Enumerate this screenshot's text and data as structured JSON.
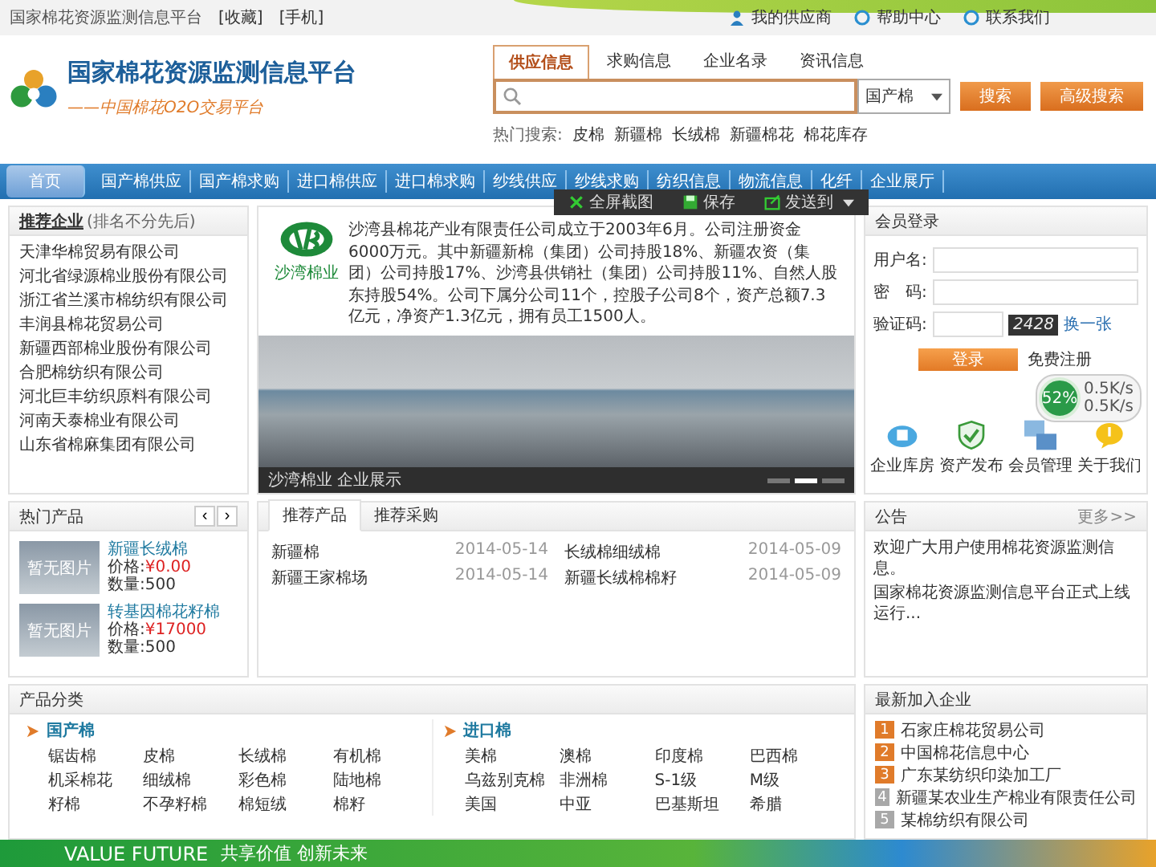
{
  "top_bar": {
    "site_name": "国家棉花资源监测信息平台",
    "links": [
      "[收藏]",
      "[手机]"
    ],
    "right_links": [
      "我的供应商",
      "帮助中心",
      "联系我们"
    ]
  },
  "header": {
    "title": "国家棉花资源监测信息平台",
    "slogan": "——中国棉花O2O交易平台",
    "search_tabs": [
      {
        "label": "供应信息",
        "selected": true
      },
      {
        "label": "求购信息",
        "selected": false
      },
      {
        "label": "企业名录",
        "selected": false
      },
      {
        "label": "资讯信息",
        "selected": false
      }
    ],
    "search": {
      "scope": "国产棉",
      "buttons": [
        "搜索",
        "高级搜索"
      ]
    },
    "hot_label": "热门搜索:",
    "hot_terms": [
      "皮棉",
      "新疆棉",
      "长绒棉",
      "新疆棉花",
      "棉花库存"
    ]
  },
  "nav": [
    {
      "label": "首页",
      "selected": true
    },
    {
      "label": "国产棉供应",
      "selected": false
    },
    {
      "label": "国产棉求购",
      "selected": false
    },
    {
      "label": "进口棉供应",
      "selected": false
    },
    {
      "label": "进口棉求购",
      "selected": false
    },
    {
      "label": "纱线供应",
      "selected": false
    },
    {
      "label": "纱线求购",
      "selected": false
    },
    {
      "label": "纺织信息",
      "selected": false
    },
    {
      "label": "物流信息",
      "selected": false
    },
    {
      "label": "化纤",
      "selected": false
    },
    {
      "label": "企业展厅",
      "selected": false
    }
  ],
  "capture_toolbar": [
    "全屏截图",
    "保存",
    "发送到"
  ],
  "recommended_companies": {
    "title": "推荐企业",
    "note": "(排名不分先后)",
    "items": [
      "天津华棉贸易有限公司",
      "河北省绿源棉业股份有限公司",
      "浙江省兰溪市棉纺织有限公司",
      "丰润县棉花贸易公司",
      "新疆西部棉业股份有限公司",
      "合肥棉纺织有限公司",
      "河北巨丰纺织原料有限公司",
      "河南天泰棉业有限公司",
      "山东省棉麻集团有限公司"
    ]
  },
  "banner": {
    "logo_caption": "沙湾棉业",
    "text": "沙湾县棉花产业有限责任公司成立于2003年6月。公司注册资金6000万元。其中新疆新棉（集团）公司持股18%、新疆农资（集团）公司持股17%、沙湾县供销社（集团）公司持股11%、自然人股东持股54%。公司下属分公司11个，控股子公司8个，资产总额7.3亿元，净资产1.3亿元，拥有员工1500人。",
    "caption": "沙湾棉业 企业展示",
    "slides": [
      {
        "selected": false
      },
      {
        "selected": true
      },
      {
        "selected": false
      }
    ]
  },
  "login": {
    "title": "会员登录",
    "fields": [
      {
        "label": "用户名:"
      },
      {
        "label": "密　码:"
      }
    ],
    "captcha_label": "验证码:",
    "captcha_image": "2428",
    "refresh": "换一张",
    "submit": "登录",
    "register": "免费注册",
    "shortcuts": [
      {
        "label": "企业库房",
        "kind": "cloud"
      },
      {
        "label": "资产发布",
        "kind": "shield"
      },
      {
        "label": "会员管理",
        "kind": "screens"
      },
      {
        "label": "关于我们",
        "kind": "bubble"
      }
    ]
  },
  "speed_widget": {
    "percent": "52%",
    "up": "0.5K/s",
    "down": "0.5K/s"
  },
  "hot_products": {
    "title": "热门产品",
    "prev": "‹",
    "next": "›",
    "items": [
      {
        "thumb": "暂无图片",
        "name": "新疆长绒棉",
        "price_label": "价格:",
        "price": "¥0.00",
        "qty_label": "数量:",
        "qty": "500"
      },
      {
        "thumb": "暂无图片",
        "name": "转基因棉花籽棉",
        "price_label": "价格:",
        "price": "¥17000",
        "qty_label": "数量:",
        "qty": "500"
      }
    ]
  },
  "product_tabs": {
    "tabs": [
      {
        "label": "推荐产品",
        "selected": true
      },
      {
        "label": "推荐采购",
        "selected": false
      }
    ],
    "rows": [
      {
        "name": "新疆棉",
        "date": "2014-05-14"
      },
      {
        "name": "新疆王家棉场",
        "date": "2014-05-14"
      },
      {
        "name": "长绒棉细绒棉",
        "date": "2014-05-09"
      },
      {
        "name": "新疆长绒棉棉籽",
        "date": "2014-05-09"
      }
    ]
  },
  "notices": {
    "title": "公告",
    "more": "更多>>",
    "items": [
      "欢迎广大用户使用棉花资源监测信息。",
      "国家棉花资源监测信息平台正式上线运行..."
    ]
  },
  "categories": {
    "title": "产品分类",
    "groups": [
      {
        "name": "国产棉",
        "items": [
          "锯齿棉",
          "皮棉",
          "长绒棉",
          "有机棉",
          "机采棉花",
          "细绒棉",
          "彩色棉",
          "陆地棉",
          "籽棉",
          "不孕籽棉",
          "棉短绒",
          "棉籽"
        ]
      },
      {
        "name": "进口棉",
        "items": [
          "美棉",
          "澳棉",
          "印度棉",
          "巴西棉",
          "乌兹别克棉",
          "非洲棉",
          "S-1级",
          "M级",
          "美国",
          "中亚",
          "巴基斯坦",
          "希腊"
        ]
      }
    ]
  },
  "new_companies": {
    "title": "最新加入企业",
    "items": [
      {
        "rank": "1",
        "name": "石家庄棉花贸易公司",
        "color": "#e07b2a"
      },
      {
        "rank": "2",
        "name": "中国棉花信息中心",
        "color": "#e07b2a"
      },
      {
        "rank": "3",
        "name": "广东某纺织印染加工厂",
        "color": "#e07b2a"
      },
      {
        "rank": "4",
        "name": "新疆某农业生产棉业有限责任公司",
        "color": "#a8a8a8"
      },
      {
        "rank": "5",
        "name": "某棉纺织有限公司",
        "color": "#a8a8a8"
      }
    ]
  },
  "footer_banner": {
    "en": "VALUE FUTURE",
    "cn": "共享价值 创新未来"
  }
}
